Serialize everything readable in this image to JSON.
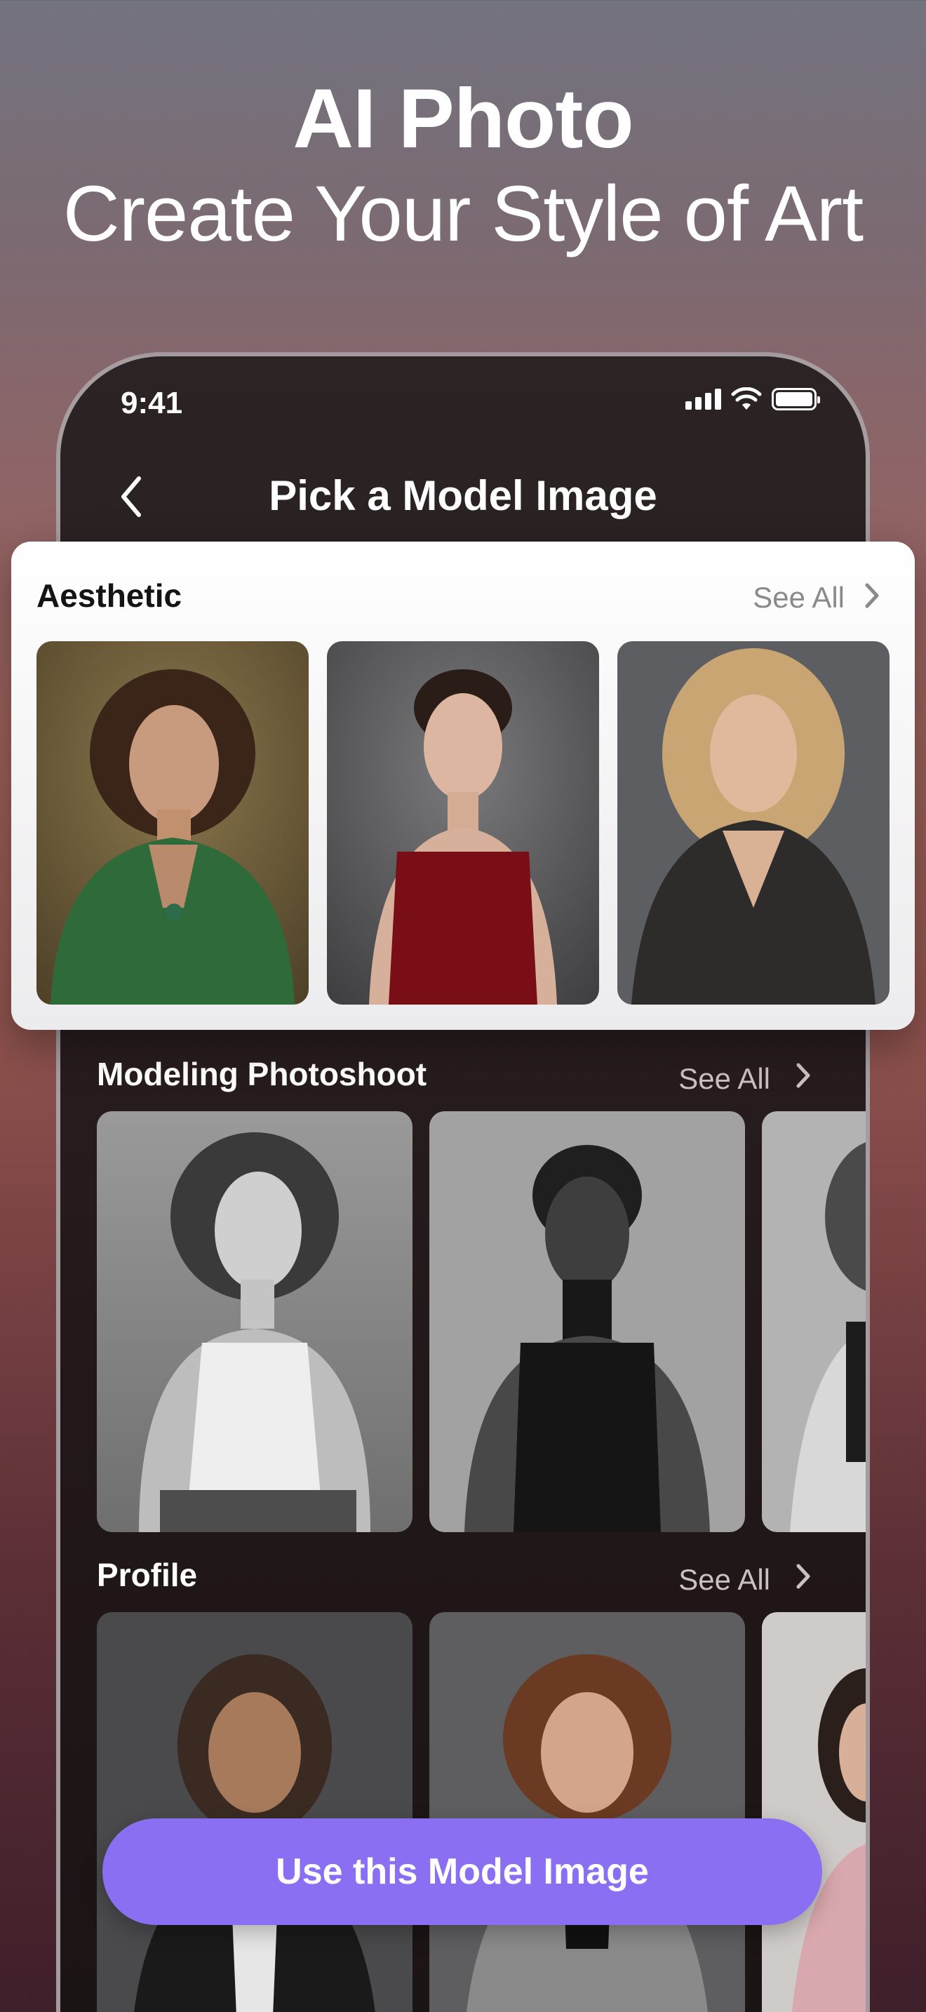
{
  "hero": {
    "title": "AI Photo",
    "subtitle": "Create Your Style of Art"
  },
  "status_bar": {
    "time": "9:41",
    "icons": [
      "signal-icon",
      "wifi-icon",
      "battery-icon"
    ]
  },
  "header": {
    "title": "Pick a Model Image",
    "back_icon": "chevron-left-icon"
  },
  "sections": [
    {
      "title": "Aesthetic",
      "see_all": "See All",
      "photos": [
        {
          "subject": "woman-green-satin-shirt",
          "bg": "#6d5a37"
        },
        {
          "subject": "woman-red-velvet-slip-dress",
          "bg": "#5a5a5c"
        },
        {
          "subject": "woman-leather-jacket",
          "bg": "#5d5e62"
        }
      ]
    },
    {
      "title": "Modeling Photoshoot",
      "see_all": "See All",
      "photos": [
        {
          "subject": "woman-white-tank-bw",
          "bg": "#8d8d8d"
        },
        {
          "subject": "woman-black-turtleneck-bw",
          "bg": "#9a9a9a"
        },
        {
          "subject": "woman-blazer-bw",
          "bg": "#a6a6a6"
        }
      ]
    },
    {
      "title": "Profile",
      "see_all": "See All",
      "photos": [
        {
          "subject": "woman-black-blazer",
          "bg": "#4a4a4c"
        },
        {
          "subject": "woman-grey-blazer",
          "bg": "#5e5e60"
        },
        {
          "subject": "woman-pink-blazer",
          "bg": "#c9c6c4"
        }
      ]
    }
  ],
  "cta": {
    "label": "Use this Model Image",
    "color": "#8a6ff2"
  }
}
